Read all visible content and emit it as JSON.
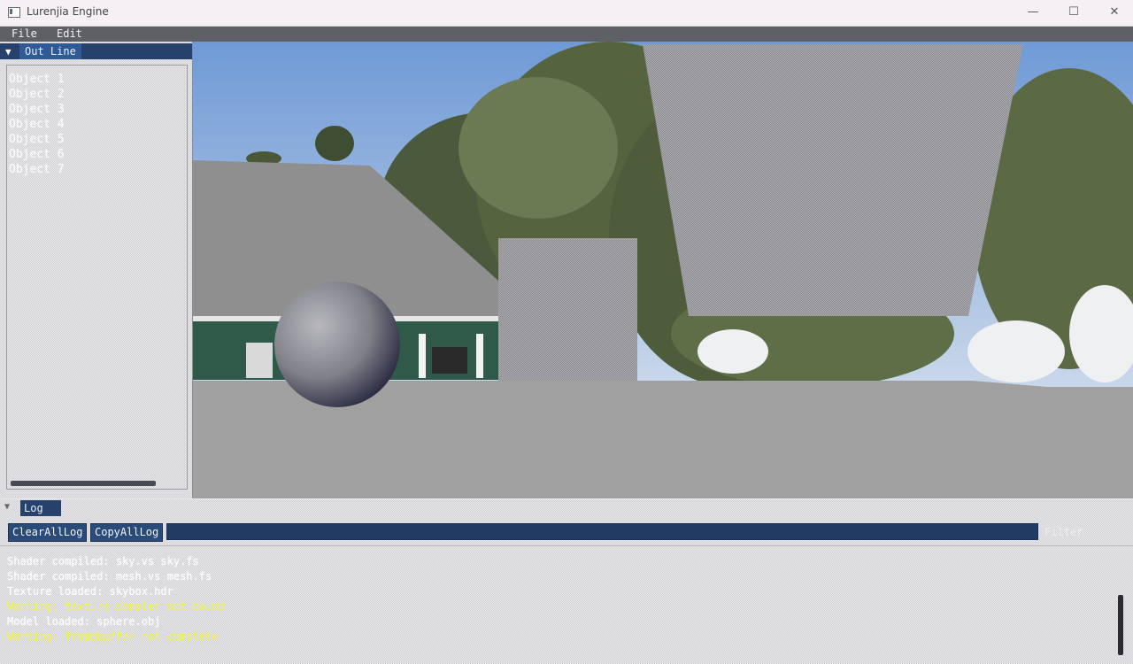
{
  "window": {
    "title": "Lurenjia Engine",
    "minimize": "—",
    "maximize": "☐",
    "close": "✕"
  },
  "menubar": {
    "file": "File",
    "edit": "Edit"
  },
  "outline": {
    "tab_label": "Out Line",
    "items": [
      "Object 1",
      "Object 2",
      "Object 3",
      "Object 4",
      "Object 5",
      "Object 6",
      "Object 7"
    ]
  },
  "viewport": {
    "label": "scene view"
  },
  "log": {
    "tab_label": "Log",
    "clear_button": "ClearAllLog",
    "copy_button": "CopyAllLog",
    "filter_label": "Filter",
    "lines": [
      {
        "text": "Shader compiled: sky.vs sky.fs",
        "color": "white"
      },
      {
        "text": "Shader compiled: mesh.vs mesh.fs",
        "color": "white"
      },
      {
        "text": "Texture loaded: skybox.hdr",
        "color": "white"
      },
      {
        "text": "Warning: texture sampler not bound",
        "color": "yellow"
      },
      {
        "text": "Model loaded: sphere.obj",
        "color": "white"
      },
      {
        "text": "Warning: framebuffer not complete",
        "color": "yellow"
      }
    ]
  }
}
